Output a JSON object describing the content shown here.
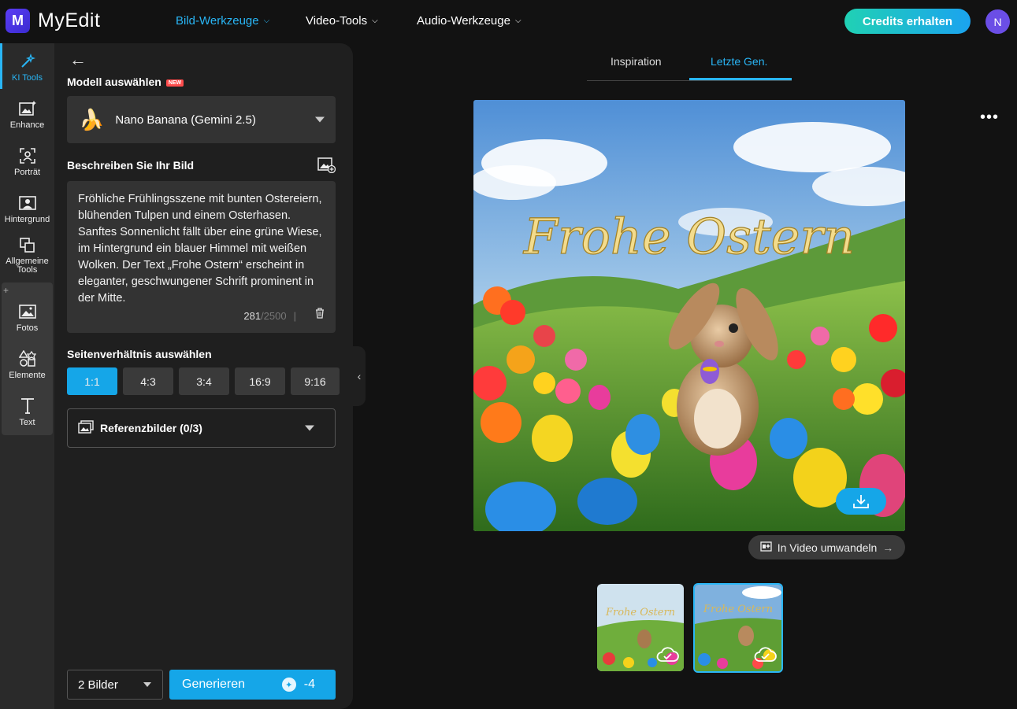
{
  "app": {
    "name": "MyEdit",
    "logo_letter": "M"
  },
  "nav": [
    {
      "label": "Bild-Werkzeuge",
      "active": true
    },
    {
      "label": "Video-Tools",
      "active": false
    },
    {
      "label": "Audio-Werkzeuge",
      "active": false
    }
  ],
  "header": {
    "credits_label": "Credits erhalten",
    "avatar_initial": "N"
  },
  "rail": {
    "items": [
      {
        "label": "KI Tools",
        "icon": "magic-wand-icon",
        "active": true
      },
      {
        "label": "Enhance",
        "icon": "image-sparkle-icon"
      },
      {
        "label": "Porträt",
        "icon": "portrait-icon"
      },
      {
        "label": "Hintergrund",
        "icon": "background-icon"
      },
      {
        "label": "Allgemeine Tools",
        "icon": "copy-icon"
      },
      {
        "label": "Fotos",
        "icon": "photo-icon"
      },
      {
        "label": "Elemente",
        "icon": "shapes-icon"
      },
      {
        "label": "Text",
        "icon": "text-icon"
      }
    ],
    "plus": "+"
  },
  "panel": {
    "model_title": "Modell auswählen",
    "new_badge": "NEW",
    "model_value": "Nano Banana (Gemini 2.5)",
    "model_icon": "🍌",
    "describe_title": "Beschreiben Sie Ihr Bild",
    "prompt": "Fröhliche Frühlingsszene mit bunten Ostereiern, blühenden Tulpen und einem Osterhasen. Sanftes Sonnenlicht fällt über eine grüne Wiese, im Hintergrund ein blauer Himmel mit weißen Wolken. Der Text „Frohe Ostern“ erscheint in eleganter, geschwungener Schrift prominent in der Mitte.",
    "char_count": "281",
    "char_max": "/2500",
    "ratio_title": "Seitenverhältnis auswählen",
    "ratios": [
      "1:1",
      "4:3",
      "3:4",
      "16:9",
      "9:16"
    ],
    "selected_ratio": "1:1",
    "reference_label": "Referenzbilder (0/3)",
    "image_count": "2 Bilder",
    "generate_label": "Generieren",
    "generate_cost": "-4"
  },
  "result": {
    "tabs": [
      "Inspiration",
      "Letzte Gen."
    ],
    "active_tab": "Letzte Gen.",
    "image_text": "Frohe Ostern",
    "video_button": "In Video umwandeln",
    "more_label": "•••"
  }
}
